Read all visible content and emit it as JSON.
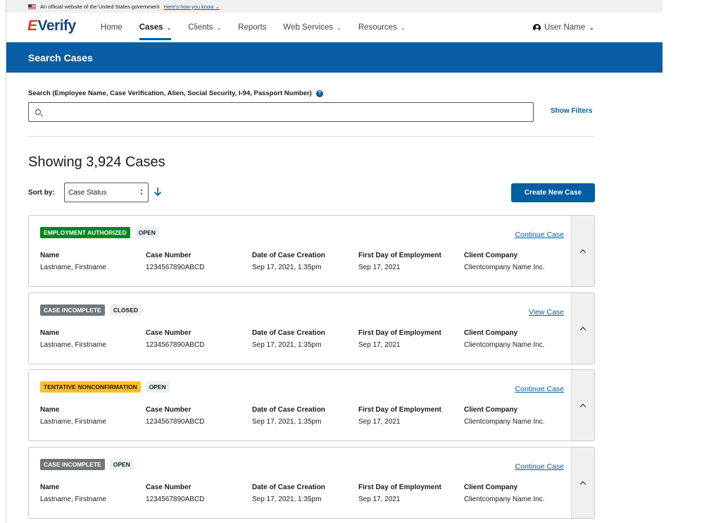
{
  "gov_banner": {
    "text": "An official website of the United States government",
    "link": "Here's how you know"
  },
  "header": {
    "logo": {
      "e": "E",
      "text": "Verify"
    },
    "nav": [
      {
        "label": "Home",
        "dropdown": false,
        "active": false
      },
      {
        "label": "Cases",
        "dropdown": true,
        "active": true
      },
      {
        "label": "Clients",
        "dropdown": true,
        "active": false
      },
      {
        "label": "Reports",
        "dropdown": false,
        "active": false
      },
      {
        "label": "Web Services",
        "dropdown": true,
        "active": false
      },
      {
        "label": "Resources",
        "dropdown": true,
        "active": false
      }
    ],
    "user": "User Name"
  },
  "page_title": "Search Cases",
  "search": {
    "label": "Search (Employee Name, Case Verification, Alien, Social Security, I-94, Passport Number)",
    "value": "",
    "show_filters": "Show Filters"
  },
  "results_count": "Showing 3,924 Cases",
  "sort": {
    "label": "Sort by:",
    "value": "Case Status"
  },
  "create_button": "Create New Case",
  "field_labels": {
    "name": "Name",
    "case_number": "Case Number",
    "date_created": "Date of Case Creation",
    "first_day": "First Day of Employment",
    "client_company": "Client Company"
  },
  "cases": [
    {
      "status": "EMPLOYMENT AUTHORIZED",
      "status_color": "#008817",
      "state": "OPEN",
      "action": "Continue Case",
      "name": "Lastname, Firstname",
      "case_number": "1234567890ABCD",
      "date_created": "Sep 17, 2021, 1:35pm",
      "first_day": "Sep 17, 2021",
      "client_company": "Clientcompany Name Inc."
    },
    {
      "status": "CASE INCOMPLETE",
      "status_color": "#71767a",
      "state": "CLOSED",
      "action": "View Case",
      "name": "Lastname, Firstname",
      "case_number": "1234567890ABCD",
      "date_created": "Sep 17, 2021, 1:35pm",
      "first_day": "Sep 17, 2021",
      "client_company": "Clientcompany Name Inc."
    },
    {
      "status": "TENTATIVE NONCONFIRMATION",
      "status_color": "#ffbe2e",
      "state": "OPEN",
      "action": "Continue Case",
      "name": "Lastname, Firstname",
      "case_number": "1234567890ABCD",
      "date_created": "Sep 17, 2021, 1:35pm",
      "first_day": "Sep 17, 2021",
      "client_company": "Clientcompany Name Inc."
    },
    {
      "status": "CASE INCOMPLETE",
      "status_color": "#71767a",
      "state": "OPEN",
      "action": "Continue Case",
      "name": "Lastname, Firstname",
      "case_number": "1234567890ABCD",
      "date_created": "Sep 17, 2021, 1:35pm",
      "first_day": "Sep 17, 2021",
      "client_company": "Clientcompany Name Inc."
    }
  ],
  "colors": {
    "primary": "#005ea2",
    "title_bar": "#0b5ea5",
    "logo_red": "#d83933",
    "logo_blue": "#1a4480"
  }
}
